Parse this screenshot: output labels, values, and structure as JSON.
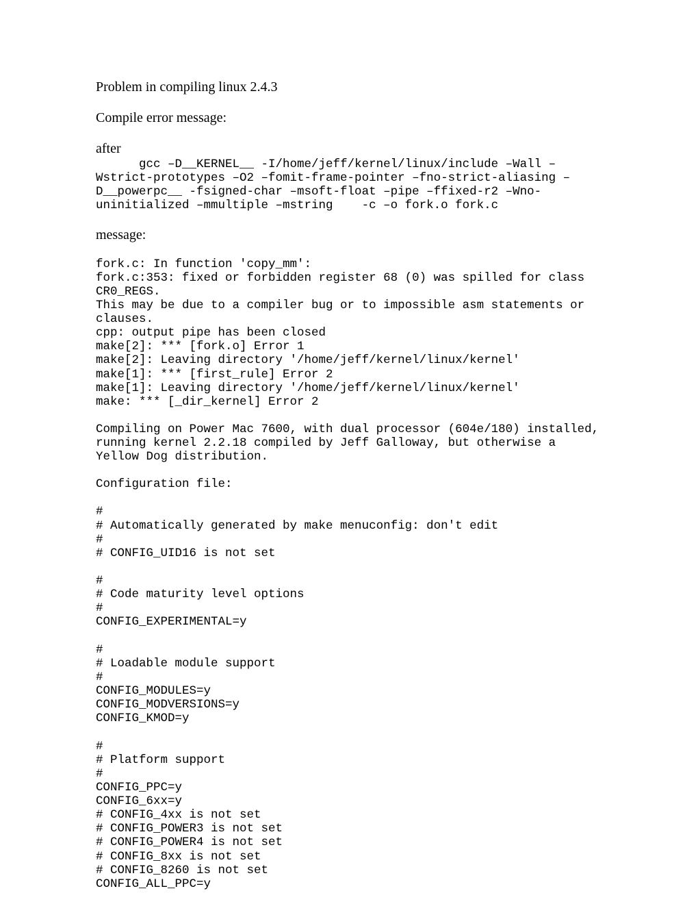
{
  "title": "Problem in compiling linux 2.4.3",
  "h_compile_err": "Compile error message:",
  "h_after": "after",
  "gcc_cmd": "      gcc –D__KERNEL__ -I/home/jeff/kernel/linux/include –Wall –Wstrict-prototypes –O2 –fomit-frame-pointer –fno-strict-aliasing –D__powerpc__ -fsigned-char –msoft-float –pipe –ffixed-r2 –Wno-uninitialized –mmultiple –mstring    -c –o fork.o fork.c",
  "h_message": "message:",
  "err_msg": "fork.c: In function 'copy_mm':\nfork.c:353: fixed or forbidden register 68 (0) was spilled for class CR0_REGS.\nThis may be due to a compiler bug or to impossible asm statements or clauses.\ncpp: output pipe has been closed\nmake[2]: *** [fork.o] Error 1\nmake[2]: Leaving directory '/home/jeff/kernel/linux/kernel'\nmake[1]: *** [first_rule] Error 2\nmake[1]: Leaving directory '/home/jeff/kernel/linux/kernel'\nmake: *** [_dir_kernel] Error 2",
  "env_note": "Compiling on Power Mac 7600, with dual processor (604e/180) installed, running kernel 2.2.18 compiled by Jeff Galloway, but otherwise a Yellow Dog distribution.",
  "h_config": "Configuration file:",
  "config_text": "#\n# Automatically generated by make menuconfig: don't edit\n#\n# CONFIG_UID16 is not set\n\n#\n# Code maturity level options\n#\nCONFIG_EXPERIMENTAL=y\n\n#\n# Loadable module support\n#\nCONFIG_MODULES=y\nCONFIG_MODVERSIONS=y\nCONFIG_KMOD=y\n\n#\n# Platform support\n#\nCONFIG_PPC=y\nCONFIG_6xx=y\n# CONFIG_4xx is not set\n# CONFIG_POWER3 is not set\n# CONFIG_POWER4 is not set\n# CONFIG_8xx is not set\n# CONFIG_8260 is not set\nCONFIG_ALL_PPC=y"
}
